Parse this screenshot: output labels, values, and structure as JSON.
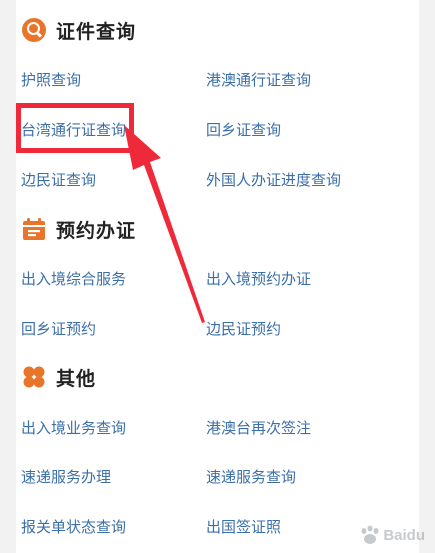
{
  "sections": [
    {
      "title": "证件查询",
      "icon": "search-icon",
      "links": [
        [
          "护照查询",
          "港澳通行证查询"
        ],
        [
          "台湾通行证查询",
          "回乡证查询"
        ],
        [
          "边民证查询",
          "外国人办证进度查询"
        ]
      ]
    },
    {
      "title": "预约办证",
      "icon": "calendar-icon",
      "links": [
        [
          "出入境综合服务",
          "出入境预约办证"
        ],
        [
          "回乡证预约",
          "边民证预约"
        ]
      ]
    },
    {
      "title": "其他",
      "icon": "clover-icon",
      "links": [
        [
          "出入境业务查询",
          "港澳台再次签注"
        ],
        [
          "速递服务办理",
          "速递服务查询"
        ],
        [
          "报关单状态查询",
          "出国签证照"
        ]
      ]
    }
  ],
  "colors": {
    "accent": "#e8752a",
    "link": "#3b6fa8",
    "annotation": "#ee2a3a"
  },
  "watermark": {
    "text": "Baidu"
  }
}
